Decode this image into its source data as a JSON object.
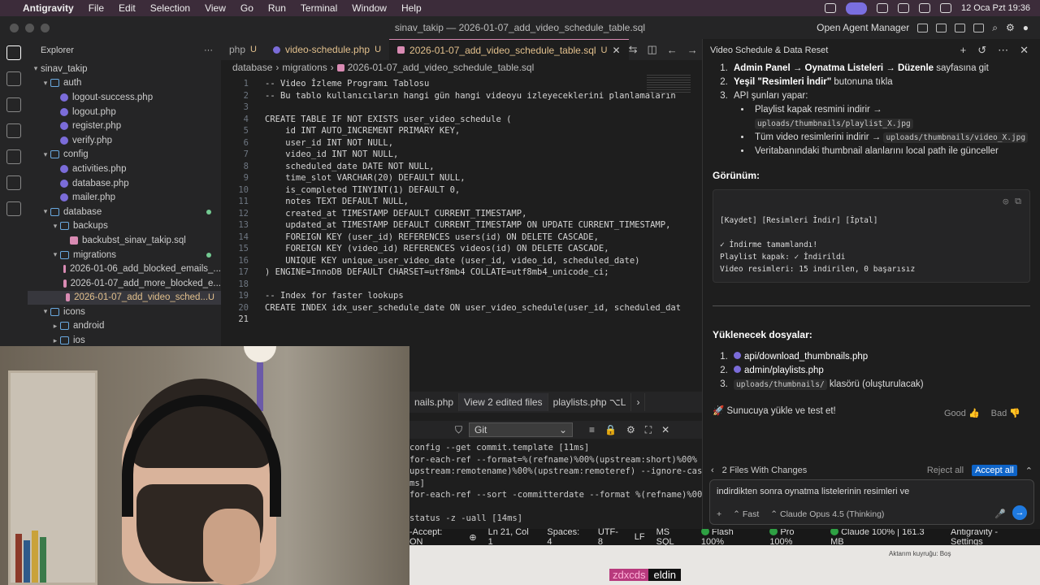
{
  "menubar": {
    "app": "Antigravity",
    "items": [
      "File",
      "Edit",
      "Selection",
      "View",
      "Go",
      "Run",
      "Terminal",
      "Window",
      "Help"
    ],
    "datetime": "12 Oca Pzt  19:36"
  },
  "titlebar": {
    "title": "sinav_takip — 2026-01-07_add_video_schedule_table.sql",
    "open_agent_manager": "Open Agent Manager"
  },
  "explorer": {
    "header": "Explorer",
    "root": "sinav_takip",
    "rows": [
      {
        "label": "auth",
        "type": "dir",
        "indent": 1,
        "open": true
      },
      {
        "label": "logout-success.php",
        "type": "php",
        "indent": 2
      },
      {
        "label": "logout.php",
        "type": "php",
        "indent": 2
      },
      {
        "label": "register.php",
        "type": "php",
        "indent": 2
      },
      {
        "label": "verify.php",
        "type": "php",
        "indent": 2
      },
      {
        "label": "config",
        "type": "dir",
        "indent": 1,
        "open": true
      },
      {
        "label": "activities.php",
        "type": "php",
        "indent": 2
      },
      {
        "label": "database.php",
        "type": "php",
        "indent": 2
      },
      {
        "label": "mailer.php",
        "type": "php",
        "indent": 2
      },
      {
        "label": "database",
        "type": "dir",
        "indent": 1,
        "open": true,
        "dot": true
      },
      {
        "label": "backups",
        "type": "dir",
        "indent": 2,
        "open": true
      },
      {
        "label": "backubst_sinav_takip.sql",
        "type": "sql",
        "indent": 3
      },
      {
        "label": "migrations",
        "type": "dir",
        "indent": 2,
        "open": true,
        "dot": true
      },
      {
        "label": "2026-01-06_add_blocked_emails_...",
        "type": "sql",
        "indent": 3
      },
      {
        "label": "2026-01-07_add_more_blocked_e...",
        "type": "sql",
        "indent": 3
      },
      {
        "label": "2026-01-07_add_video_sched...",
        "type": "sql",
        "indent": 3,
        "selected": true,
        "badge": "U"
      },
      {
        "label": "icons",
        "type": "dir",
        "indent": 1,
        "open": true
      },
      {
        "label": "android",
        "type": "dir",
        "indent": 2,
        "open": false
      },
      {
        "label": "ios",
        "type": "dir",
        "indent": 2,
        "open": false
      }
    ]
  },
  "tabs": [
    {
      "label": "php",
      "badge": "U",
      "active": false
    },
    {
      "label": "video-schedule.php",
      "badge": "U",
      "active": false
    },
    {
      "label": "2026-01-07_add_video_schedule_table.sql",
      "badge": "U",
      "active": true
    }
  ],
  "breadcrumb": [
    "database",
    "migrations",
    "2026-01-07_add_video_schedule_table.sql"
  ],
  "code_lines": [
    "-- Video İzleme Programı Tablosu",
    "-- Bu tablo kullanıcıların hangi gün hangi videoyu izleyeceklerini planlamaların",
    "",
    "CREATE TABLE IF NOT EXISTS user_video_schedule (",
    "    id INT AUTO_INCREMENT PRIMARY KEY,",
    "    user_id INT NOT NULL,",
    "    video_id INT NOT NULL,",
    "    scheduled_date DATE NOT NULL,",
    "    time_slot VARCHAR(20) DEFAULT NULL,",
    "    is_completed TINYINT(1) DEFAULT 0,",
    "    notes TEXT DEFAULT NULL,",
    "    created_at TIMESTAMP DEFAULT CURRENT_TIMESTAMP,",
    "    updated_at TIMESTAMP DEFAULT CURRENT_TIMESTAMP ON UPDATE CURRENT_TIMESTAMP,",
    "    FOREIGN KEY (user_id) REFERENCES users(id) ON DELETE CASCADE,",
    "    FOREIGN KEY (video_id) REFERENCES videos(id) ON DELETE CASCADE,",
    "    UNIQUE KEY unique_user_video_date (user_id, video_id, scheduled_date)",
    ") ENGINE=InnoDB DEFAULT CHARSET=utf8mb4 COLLATE=utf8mb4_unicode_ci;",
    "",
    "-- Index for faster lookups",
    "CREATE INDEX idx_user_schedule_date ON user_video_schedule(user_id, scheduled_dat",
    ""
  ],
  "panel": {
    "tabs": [
      "nails.php",
      "View 2 edited files",
      "playlists.php ⌥L"
    ],
    "terminal_select": "Git",
    "terminal_lines": [
      "config --get commit.template [11ms]",
      "for-each-ref --format=%(refname)%00%(upstream:short)%00%",
      "upstream:remotename)%00%(upstream:remoteref) --ignore-case",
      "ms]",
      "for-each-ref --sort -committerdate --format %(refname)%00%",
      "",
      "status -z -uall [14ms]"
    ]
  },
  "status": {
    "accept": "-Accept: ON",
    "position": "Ln 21, Col 1",
    "spaces": "Spaces: 4",
    "encoding": "UTF-8",
    "eol": "LF",
    "lang": "MS SQL",
    "flash": "Flash 100%",
    "pro": "Pro 100%",
    "claude": "Claude 100% | 161.3 MB",
    "settings": "Antigravity - Settings"
  },
  "agent": {
    "title": "Video Schedule & Data Reset",
    "steps": [
      {
        "bold": "Admin Panel → Oynatma Listeleri → Düzenle",
        "rest": " sayfasına git"
      },
      {
        "bold": "Yeşil \"Resimleri İndir\"",
        "rest": " butonuna tıkla"
      },
      {
        "bold": "",
        "rest": "API şunları yapar:"
      }
    ],
    "sub": [
      {
        "text": "Playlist kapak resmini indirir → ",
        "code": "uploads/thumbnails/playlist_X.jpg"
      },
      {
        "text": "Tüm video resimlerini indirir → ",
        "code": "uploads/thumbnails/video_X.jpg"
      },
      {
        "text": "Veritabanındaki thumbnail alanlarını local path ile günceller",
        "code": ""
      }
    ],
    "view_heading": "Görünüm:",
    "codebox": "[Kaydet] [Resimleri İndir] [İptal]\n\n✓ İndirme tamamlandı!\nPlaylist kapak: ✓ İndirildi\nVideo resimleri: 15 indirilen, 0 başarısız",
    "files_heading": "Yüklenecek dosyalar:",
    "files": [
      {
        "text": "api/download_thumbnails.php",
        "code": false,
        "rest": ""
      },
      {
        "text": "admin/playlists.php",
        "code": false,
        "rest": ""
      },
      {
        "text": "uploads/thumbnails/",
        "code": true,
        "rest": " klasörü (oluşturulacak)"
      }
    ],
    "final": "🚀 Sunucuya yükle ve test et!",
    "good": "Good",
    "bad": "Bad",
    "changes": "2 Files With Changes",
    "reject_all": "Reject all",
    "accept_all": "Accept all",
    "input_text": "indirdikten sonra oynatma listelerinin resimleri ve",
    "mode": "Fast",
    "model": "Claude Opus 4.5 (Thinking)"
  },
  "dock": {
    "text": "Aktarım kuyruğu: Boş"
  },
  "chat": {
    "nick": "zdxcds",
    "msg": "eldin"
  }
}
